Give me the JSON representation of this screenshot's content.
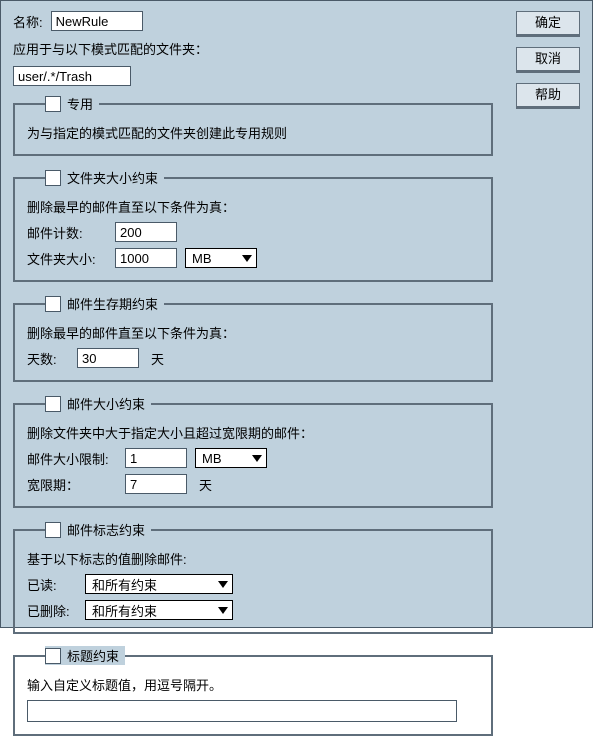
{
  "buttons": {
    "ok": "确定",
    "cancel": "取消",
    "help": "帮助"
  },
  "name": {
    "label": "名称:",
    "value": "NewRule"
  },
  "applies": {
    "label": "应用于与以下模式匹配的文件夹：",
    "value": "user/.*/Trash"
  },
  "exclusive": {
    "title": "专用",
    "desc": "为与指定的模式匹配的文件夹创建此专用规则"
  },
  "folderSize": {
    "title": "文件夹大小约束",
    "desc": "删除最早的邮件直至以下条件为真：",
    "count_label": "邮件计数:",
    "count_value": "200",
    "size_label": "文件夹大小:",
    "size_value": "1000",
    "size_unit": "MB"
  },
  "age": {
    "title": "邮件生存期约束",
    "desc": "删除最早的邮件直至以下条件为真：",
    "days_label": "天数:",
    "days_value": "30",
    "days_unit": "天"
  },
  "msgSize": {
    "title": "邮件大小约束",
    "desc": "删除文件夹中大于指定大小且超过宽限期的邮件：",
    "limit_label": "邮件大小限制:",
    "limit_value": "1",
    "limit_unit": "MB",
    "grace_label": "宽限期：",
    "grace_value": "7",
    "grace_unit": "天"
  },
  "flags": {
    "title": "邮件标志约束",
    "desc": "基于以下标志的值删除邮件:",
    "read_label": "已读:",
    "read_value": "和所有约束",
    "deleted_label": "已删除:",
    "deleted_value": "和所有约束"
  },
  "header": {
    "title": "标题约束",
    "desc": "输入自定义标题值，用逗号隔开。",
    "value": ""
  }
}
